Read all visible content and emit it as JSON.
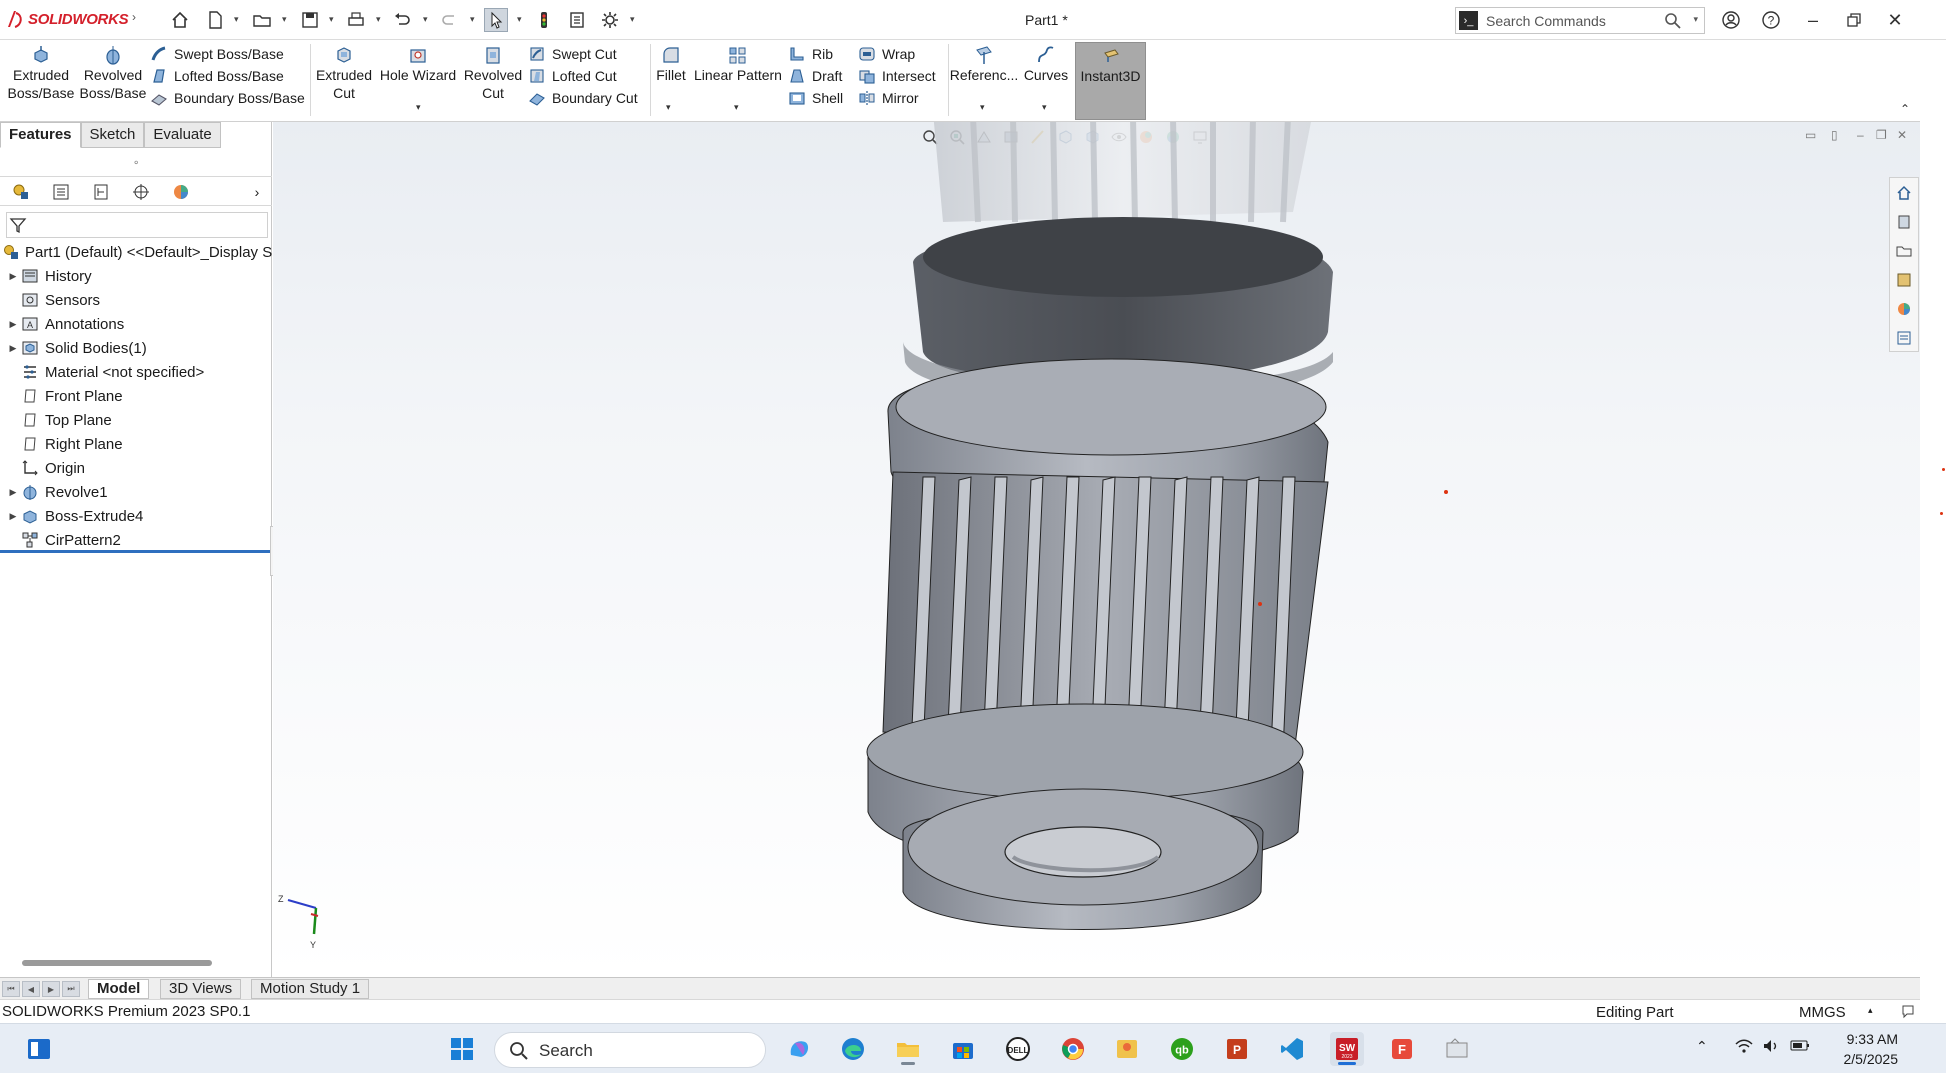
{
  "app": {
    "logo_prefix": "DS",
    "logo_name": "SOLIDWORKS",
    "document_title": "Part1 *",
    "search_placeholder": "Search Commands"
  },
  "command_manager": {
    "extruded_boss": "Extruded Boss/Base",
    "revolved_boss": "Revolved Boss/Base",
    "swept_boss": "Swept Boss/Base",
    "lofted_boss": "Lofted Boss/Base",
    "boundary_boss": "Boundary Boss/Base",
    "extruded_cut": "Extruded Cut",
    "hole_wizard": "Hole Wizard",
    "revolved_cut": "Revolved Cut",
    "swept_cut": "Swept Cut",
    "lofted_cut": "Lofted Cut",
    "boundary_cut": "Boundary Cut",
    "fillet": "Fillet",
    "linear_pattern": "Linear Pattern",
    "rib": "Rib",
    "draft": "Draft",
    "shell": "Shell",
    "wrap": "Wrap",
    "intersect": "Intersect",
    "mirror": "Mirror",
    "reference": "Referenc...",
    "curves": "Curves",
    "instant3d": "Instant3D"
  },
  "left_panel": {
    "tabs": [
      "Features",
      "Sketch",
      "Evaluate"
    ],
    "active_tab": "Features",
    "tree": [
      {
        "label": "Part1 (Default) <<Default>_Display S",
        "expandable": false,
        "icon": "part-icon"
      },
      {
        "label": "History",
        "expandable": true,
        "icon": "history-icon"
      },
      {
        "label": "Sensors",
        "expandable": false,
        "icon": "sensors-icon"
      },
      {
        "label": "Annotations",
        "expandable": true,
        "icon": "annotations-icon"
      },
      {
        "label": "Solid Bodies(1)",
        "expandable": true,
        "icon": "solid-bodies-icon"
      },
      {
        "label": "Material <not specified>",
        "expandable": false,
        "icon": "material-icon"
      },
      {
        "label": "Front Plane",
        "expandable": false,
        "icon": "plane-icon"
      },
      {
        "label": "Top Plane",
        "expandable": false,
        "icon": "plane-icon"
      },
      {
        "label": "Right Plane",
        "expandable": false,
        "icon": "plane-icon"
      },
      {
        "label": "Origin",
        "expandable": false,
        "icon": "origin-icon"
      },
      {
        "label": "Revolve1",
        "expandable": true,
        "icon": "revolve-icon"
      },
      {
        "label": "Boss-Extrude4",
        "expandable": true,
        "icon": "extrude-icon"
      },
      {
        "label": "CirPattern2",
        "expandable": false,
        "icon": "circular-pattern-icon"
      }
    ]
  },
  "bottom_tabs": {
    "model": "Model",
    "views_3d": "3D Views",
    "motion_study": "Motion Study 1"
  },
  "status_bar": {
    "product": "SOLIDWORKS Premium 2023 SP0.1",
    "mode": "Editing Part",
    "units": "MMGS"
  },
  "taskbar": {
    "search_label": "Search",
    "time": "9:33 AM",
    "date": "2/5/2025"
  },
  "colors": {
    "brand_red": "#d4202b",
    "rollback_blue": "#2f6fbf",
    "model_gray": "#9da3ad"
  }
}
